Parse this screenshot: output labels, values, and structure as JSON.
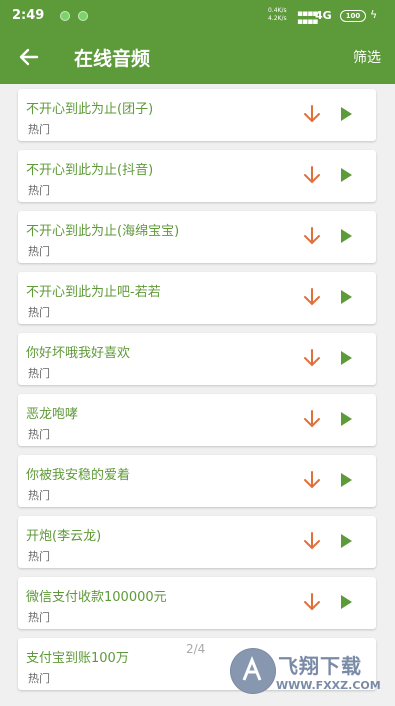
{
  "status_bar": {
    "time": "2:49",
    "speed_up": "0.4K/s",
    "speed_down": "4.2K/s",
    "network": "4G",
    "battery": "100"
  },
  "app_bar": {
    "title": "在线音频",
    "filter_label": "筛选"
  },
  "items": [
    {
      "title": "不开心到此为止(团子)",
      "tag": "热门"
    },
    {
      "title": "不开心到此为止(抖音)",
      "tag": "热门"
    },
    {
      "title": "不开心到此为止(海绵宝宝)",
      "tag": "热门"
    },
    {
      "title": "不开心到此为止吧-若若",
      "tag": "热门"
    },
    {
      "title": "你好坏哦我好喜欢",
      "tag": "热门"
    },
    {
      "title": "恶龙咆哮",
      "tag": "热门"
    },
    {
      "title": "你被我安稳的爱着",
      "tag": "热门"
    },
    {
      "title": "开炮(李云龙)",
      "tag": "热门"
    },
    {
      "title": "微信支付收款100000元",
      "tag": "热门"
    },
    {
      "title": "支付宝到账100万",
      "tag": "热门"
    }
  ],
  "page_indicator": "2/4",
  "watermark": {
    "brand": "飞翔下载",
    "url": "WWW.FXXZ.COM"
  },
  "colors": {
    "primary": "#5c9a3a",
    "title_text": "#5f9a39",
    "download_icon": "#e0703a",
    "background": "#f0f0f0"
  },
  "icons": {
    "back": "back-arrow-icon",
    "download": "download-arrow-icon",
    "play": "play-icon"
  }
}
